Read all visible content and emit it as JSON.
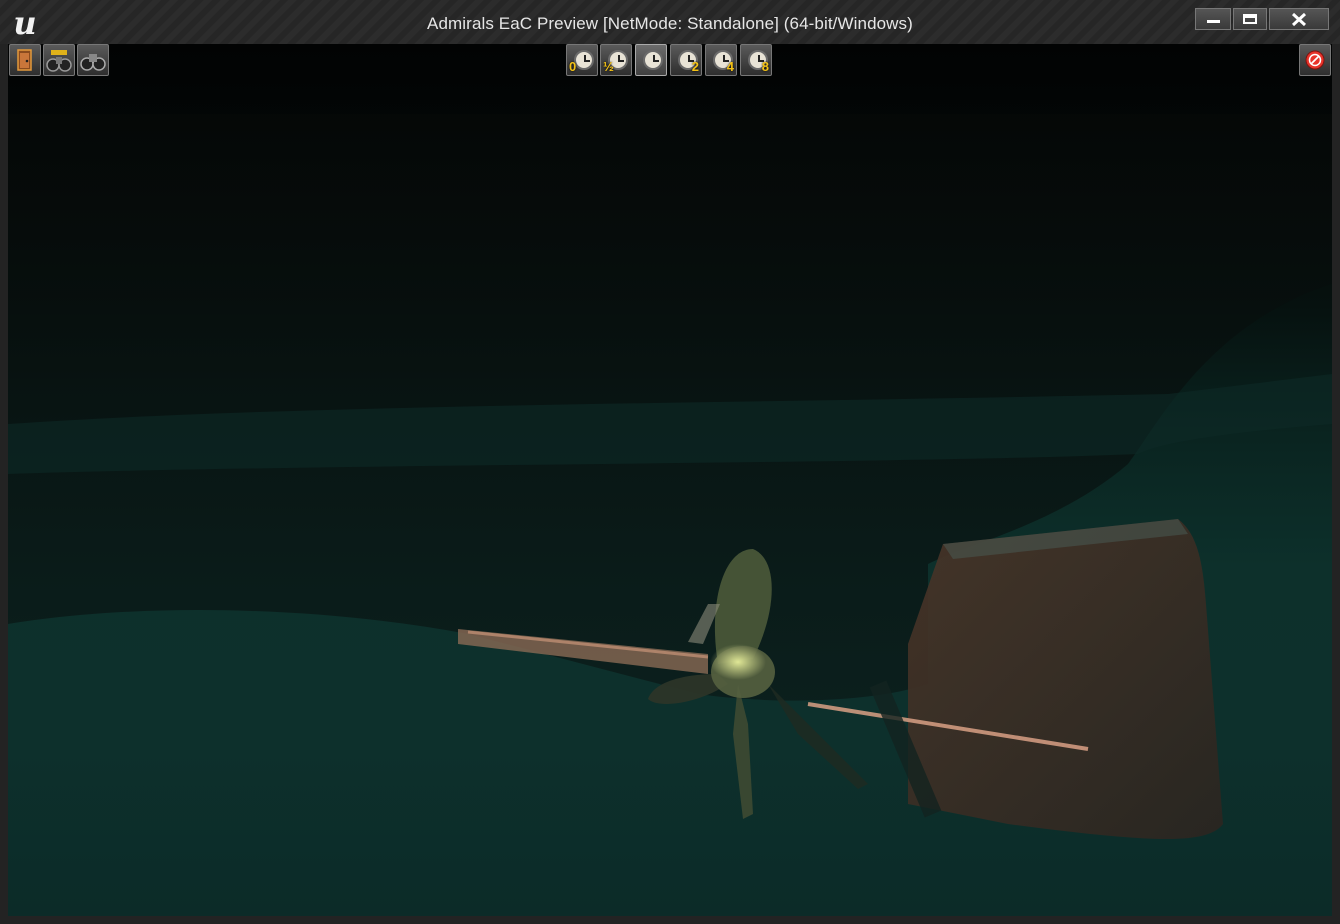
{
  "window": {
    "title": "Admirals EaC Preview [NetMode: Standalone]  (64-bit/Windows)",
    "logo_icon": "unreal-engine-logo",
    "logo_text": "u",
    "controls": [
      "minimize-icon",
      "maximize-icon",
      "close-icon"
    ]
  },
  "toolbar_left": [
    {
      "name": "exit-door-button",
      "icon": "door-icon"
    },
    {
      "name": "binoculars-alt-button",
      "icon": "binoculars-icon"
    },
    {
      "name": "binoculars-button",
      "icon": "binoculars-icon"
    }
  ],
  "time_speed": {
    "options": [
      {
        "label": "0",
        "icon": "clock-icon",
        "active": false
      },
      {
        "label": "½",
        "icon": "clock-icon",
        "active": false
      },
      {
        "label": "",
        "icon": "clock-icon",
        "active": true
      },
      {
        "label": "2",
        "icon": "clock-icon",
        "active": false
      },
      {
        "label": "4",
        "icon": "clock-icon",
        "active": false
      },
      {
        "label": "8",
        "icon": "clock-icon",
        "active": false
      }
    ]
  },
  "toolbar_right": {
    "name": "no-entry-button",
    "icon": "prohibited-icon",
    "color": "#e8332a"
  },
  "scene": {
    "description_icon": "underwater-ship-stern",
    "colors": {
      "water": "#0d302b",
      "hull": "#0a1a18",
      "rudder": "#3c2d22",
      "propeller": "#4b5a3a",
      "light": "#f0f7a0"
    }
  }
}
